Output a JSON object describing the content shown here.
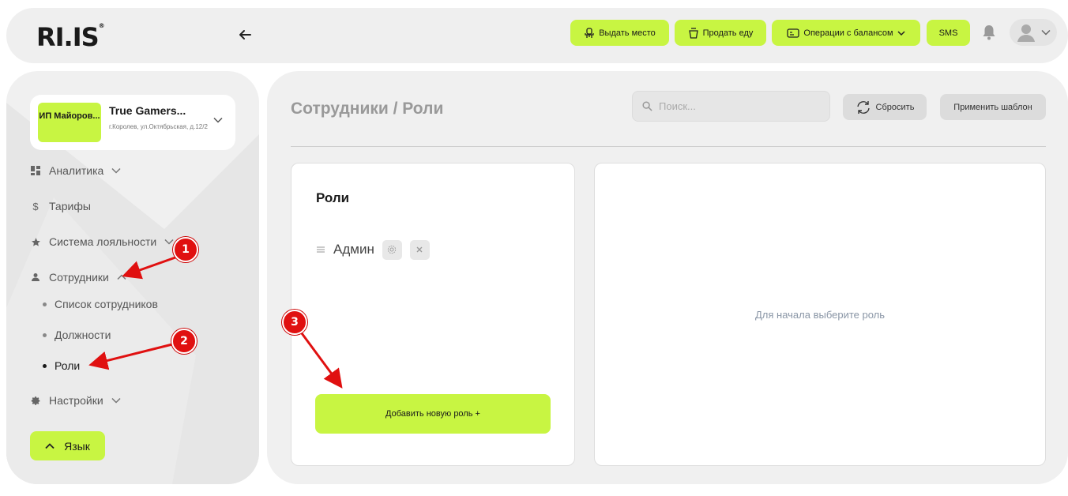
{
  "header": {
    "logo_text": "RI.IS",
    "logo_mark": "®",
    "buttons": {
      "issue_place": "Выдать место",
      "sell_food": "Продать еду",
      "balance_ops": "Операции с балансом",
      "sms": "SMS"
    }
  },
  "sidebar": {
    "club": {
      "badge": "ИП Майоров...",
      "name": "True Gamers...",
      "address": "г.Королев, ул.Октябрьская, д.12/2"
    },
    "items": {
      "analytics": "Аналитика",
      "tariffs": "Тарифы",
      "loyalty": "Система лояльности",
      "employees": "Сотрудники",
      "settings": "Настройки"
    },
    "subitems": {
      "employee_list": "Список сотрудников",
      "positions": "Должности",
      "roles": "Роли"
    },
    "language_button": "Язык"
  },
  "main": {
    "title": "Сотрудники / Роли",
    "search_placeholder": "Поиск...",
    "reset_label": "Сбросить",
    "apply_template_label": "Применить шаблон",
    "roles_card": {
      "title": "Роли",
      "roles": [
        "Админ"
      ],
      "add_button": "Добавить новую роль +"
    },
    "detail_empty_text": "Для начала выберите роль"
  },
  "annotations": {
    "markers": [
      "1",
      "2",
      "3"
    ],
    "color": "#e01010"
  },
  "colors": {
    "accent": "#c8f542",
    "panel": "#f0f0f0"
  }
}
